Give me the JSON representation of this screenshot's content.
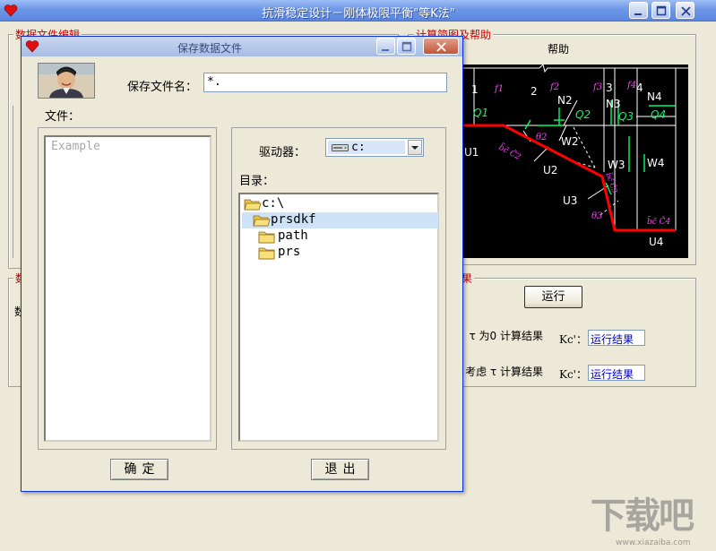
{
  "main_window": {
    "title": "抗滑稳定设计－刚体极限平衡\"等K法\"",
    "groups": {
      "data_edit_title": "数据文件编辑",
      "diagram_help_title": "计算简图及帮助",
      "left_lower_title_fragment": "数",
      "left_lower_text_fragment": "数",
      "results_title_fragment": "果"
    },
    "help_label": "帮助",
    "run_button_label": "运行",
    "result_row_1_label": "τ 为0 计算结果：",
    "result_row_2_label": "考虑 τ 计算结果：",
    "kc_label_1": "Kc'：",
    "kc_label_2": "Kc'：",
    "result_value_1": "运行结果",
    "result_value_2": "运行结果",
    "diagram_labels": {
      "n1": "1",
      "n2": "2",
      "n3": "3",
      "n4": "4",
      "q1": "Q1",
      "q2": "Q2",
      "q3": "Q3",
      "q4": "Q4",
      "n2w": "N2",
      "n3w": "N3",
      "n4w": "N4",
      "w2": "W2",
      "w3": "W3",
      "w4": "W4",
      "u1": "U1",
      "u2": "U2",
      "u3": "U3",
      "u4": "U4",
      "f2": "f2",
      "f3": "f3",
      "f4": "f4",
      "f1": "f1",
      "th1": "θ2",
      "th2": "θ3",
      "bc1": "b̃c̃ C̃2",
      "bc2": "b̃c̃ C̃3",
      "bc3": "b̃c̃ C̃4"
    }
  },
  "dialog": {
    "title": "保存数据文件",
    "filename_label": "保存文件名：",
    "filename_value": "*.",
    "files_label": "文件：",
    "file_list": [
      "Example"
    ],
    "drive_label": "驱动器：",
    "drive_value": "c:",
    "directory_label": "目录：",
    "directories": [
      {
        "name": "c:\\",
        "state": "open"
      },
      {
        "name": "prsdkf",
        "state": "open",
        "selected": true
      },
      {
        "name": "path",
        "state": "closed"
      },
      {
        "name": "prs",
        "state": "closed"
      }
    ],
    "ok_button": "确定",
    "exit_button": "退出"
  },
  "watermark": {
    "text": "下载吧",
    "site": "www.xiazaiba.com"
  },
  "colors": {
    "title_blue": "#6e97e6",
    "group_title_red": "#cc0000",
    "diagram_bg": "#000000",
    "slip_line_red": "#ff0000",
    "label_green": "#00ff66",
    "label_magenta": "#ff40ff",
    "selection": "#cfe3f8"
  },
  "icons": {
    "app": "red-heart-icon",
    "minimize": "minimize-icon",
    "maximize": "maximize-icon",
    "close": "close-icon",
    "drive": "hard-drive-icon",
    "folder_open": "open-folder-icon",
    "folder_closed": "closed-folder-icon",
    "dropdown": "chevron-down-icon"
  }
}
